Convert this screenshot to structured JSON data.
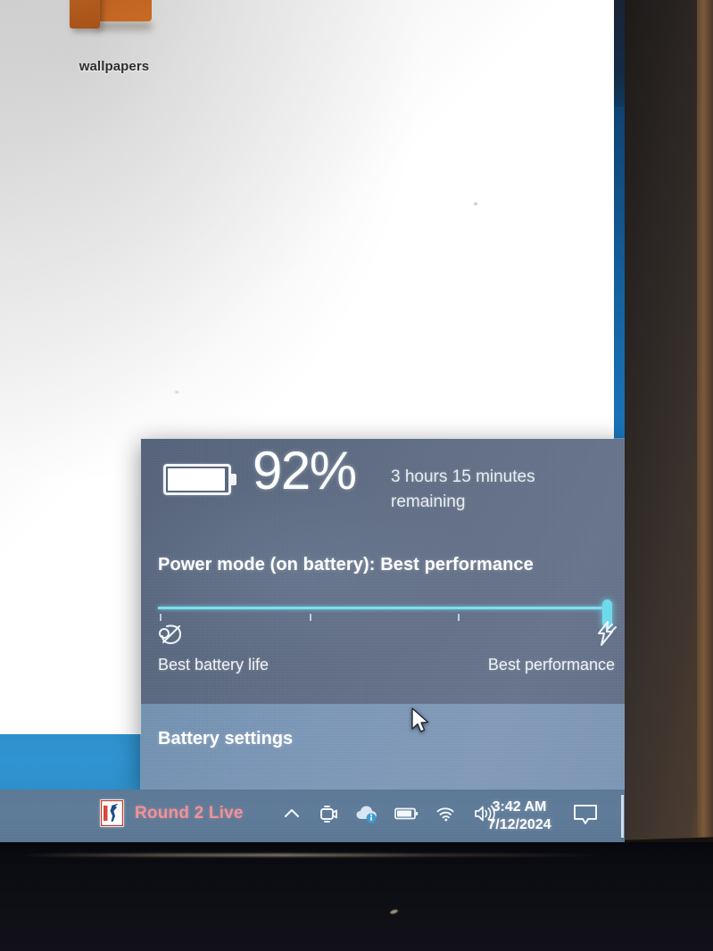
{
  "desktop": {
    "icon": {
      "label": "wallpapers",
      "icon_name": "folder-icon"
    }
  },
  "battery_flyout": {
    "percent": "92%",
    "remaining": "3 hours 15 minutes remaining",
    "battery_icon_name": "battery-full-icon",
    "power_mode_label": "Power mode (on battery): Best performance",
    "slider": {
      "min_label": "Best battery life",
      "max_label": "Best performance",
      "min_icon_name": "leaf-icon",
      "max_icon_name": "lightning-bolt-icon",
      "value": 100,
      "tick_count": 4,
      "accent_color": "#7ddff0"
    },
    "settings_link": "Battery settings",
    "background_color": "#5f6c84",
    "settings_background_color": "#7b96b6"
  },
  "taskbar": {
    "app": {
      "label": "Round 2 Live",
      "label_color": "#f0929a",
      "icon_name": "pga-tour-logo-icon"
    },
    "tray": [
      {
        "icon_name": "chevron-up-icon",
        "label": "Show hidden icons"
      },
      {
        "icon_name": "screen-capture-icon",
        "label": "Screen capture"
      },
      {
        "icon_name": "onedrive-cloud-info-icon",
        "label": "OneDrive"
      },
      {
        "icon_name": "battery-icon",
        "label": "Battery"
      },
      {
        "icon_name": "wifi-icon",
        "label": "Network"
      },
      {
        "icon_name": "volume-icon",
        "label": "Volume"
      }
    ],
    "clock": {
      "time": "3:42 AM",
      "date": "7/12/2024"
    },
    "action_center_icon_name": "action-center-icon",
    "background_color": "#5e7b99"
  }
}
